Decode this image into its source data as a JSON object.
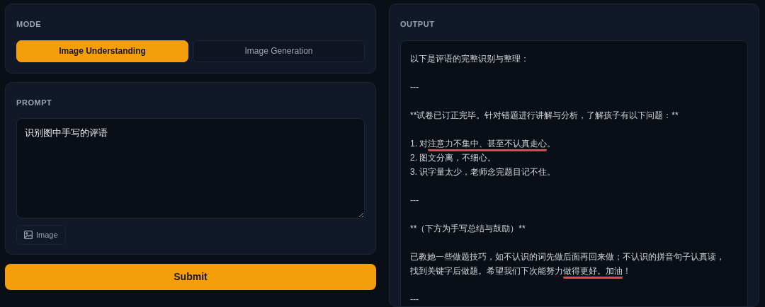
{
  "mode": {
    "label": "MODE",
    "options": [
      {
        "label": "Image Understanding",
        "selected": true
      },
      {
        "label": "Image Generation",
        "selected": false
      }
    ]
  },
  "prompt": {
    "label": "PROMPT",
    "value": "识别图中手写的评语",
    "attach_button": "Image"
  },
  "submit_button": "Submit",
  "output": {
    "label": "OUTPUT",
    "paragraphs": [
      {
        "lines": [
          {
            "segments": [
              {
                "text": "以下是评语的完整识别与整理：",
                "underlined": false
              }
            ]
          }
        ]
      },
      {
        "lines": [
          {
            "segments": [
              {
                "text": "---",
                "underlined": false
              }
            ]
          }
        ]
      },
      {
        "lines": [
          {
            "segments": [
              {
                "text": "**试卷已订正完毕。针对错题进行讲解与分析，了解孩子有以下问题：**",
                "underlined": false
              }
            ]
          }
        ]
      },
      {
        "lines": [
          {
            "segments": [
              {
                "text": "1. 对",
                "underlined": false
              },
              {
                "text": "注意力不集中、甚至不认真走心",
                "underlined": true
              },
              {
                "text": "。",
                "underlined": false
              }
            ]
          },
          {
            "segments": [
              {
                "text": "2. 图文分离，不细心。",
                "underlined": false
              }
            ]
          },
          {
            "segments": [
              {
                "text": "3. 识字量太少，老师念完题目记不住。",
                "underlined": false
              }
            ]
          }
        ]
      },
      {
        "lines": [
          {
            "segments": [
              {
                "text": "---",
                "underlined": false
              }
            ]
          }
        ]
      },
      {
        "lines": [
          {
            "segments": [
              {
                "text": "**（下方为手写总结与鼓励）**",
                "underlined": false
              }
            ]
          }
        ]
      },
      {
        "lines": [
          {
            "segments": [
              {
                "text": "已教她一些做题技巧，如不认识的词先做后面再回来做；不认识的拼音句子认真读，",
                "underlined": false
              }
            ]
          },
          {
            "segments": [
              {
                "text": "找到关键字后做题。希望我们下次能努力",
                "underlined": false
              },
              {
                "text": "做得更好。加油",
                "underlined": true
              },
              {
                "text": "！",
                "underlined": false
              }
            ]
          }
        ]
      },
      {
        "lines": [
          {
            "segments": [
              {
                "text": "---",
                "underlined": false
              }
            ]
          }
        ]
      }
    ]
  }
}
